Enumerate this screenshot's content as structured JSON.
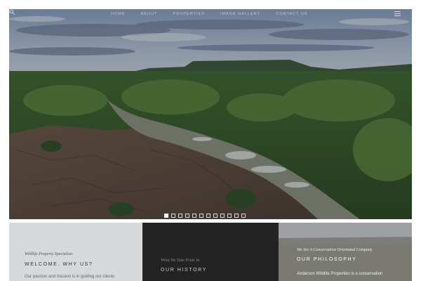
{
  "nav": {
    "items": [
      "Home",
      "About",
      "Properties",
      "Image Gallery",
      "Contact Us"
    ],
    "search_icon": "search-icon",
    "menu_icon": "hamburger-menu-icon"
  },
  "slider": {
    "slide_count": 12,
    "active_index": 0
  },
  "panels": {
    "welcome": {
      "kicker": "Wildlife Property Specialists",
      "title": "Welcome. Why Us?",
      "body": "Our passion and mission is in guiding our clients"
    },
    "history": {
      "kicker": "What We Take Pride In",
      "title": "Our History"
    },
    "philosophy": {
      "kicker": "We Are A Conservation Orientated Company",
      "title": "Our Philosophy",
      "body": "Anderson Wildlife Properties is a conservation"
    }
  },
  "colors": {
    "panel_light": "#d6d8da",
    "panel_dark": "#232323",
    "panel_mid": "#8e8f90"
  }
}
